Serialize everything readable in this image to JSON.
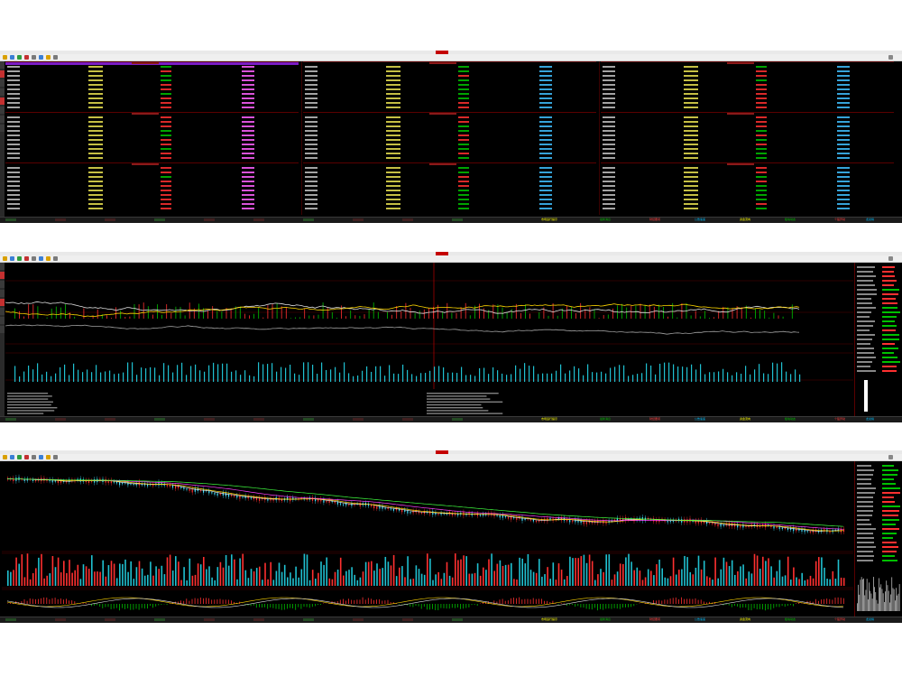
{
  "app": {
    "brand_color": "#c40000",
    "window_count": 3
  },
  "toolbar": {
    "icons": [
      "back-icon",
      "forward-icon",
      "home-icon",
      "refresh-icon",
      "search-icon",
      "chart-icon",
      "list-icon",
      "settings-icon"
    ]
  },
  "status_ticker": {
    "colors": [
      "#ffff00",
      "#00c000",
      "#ff4040",
      "#00c0ff"
    ],
    "notes": [
      "市场运行提示",
      "最新消息",
      "财经要闻",
      "公告速递",
      "资金流向",
      "板块动态",
      "个股异动",
      "龙虎榜"
    ]
  },
  "quote_panel": {
    "rows_per_block": 10,
    "blocks": 3
  },
  "colors": {
    "background": "#000000",
    "grid_red": "#5a0000",
    "up": "#ff3030",
    "down": "#00c000",
    "line_white": "#e0e0e0",
    "line_yellow": "#ffd700",
    "line_cyan": "#40e0ff",
    "volume_cyan": "#20c0d0",
    "selection": "#7a1cc4"
  }
}
